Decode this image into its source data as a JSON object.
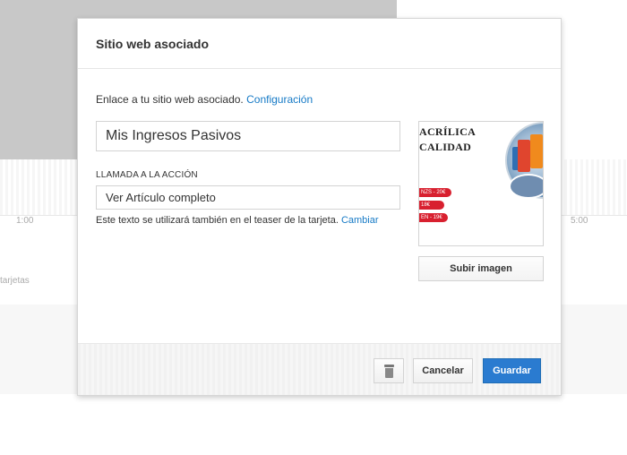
{
  "background": {
    "ticks": [
      "1:00",
      "5:00"
    ],
    "cards_label": "tarjetas"
  },
  "modal": {
    "title": "Sitio web asociado",
    "intro_text": "Enlace a tu sitio web asociado.",
    "intro_link": "Configuración",
    "title_field_value": "Mis Ingresos Pasivos",
    "cta_label": "LLAMADA A LA ACCIÓN",
    "cta_field_value": "Ver Artículo completo",
    "helper_text": "Este texto se utilizará también en el teaser de la tarjeta.",
    "helper_link": "Cambiar",
    "thumbnail": {
      "line1": "ACRÍLICA",
      "line2": "CALIDAD",
      "tags": [
        "NZS - 20€",
        "18€",
        "EN - 19€"
      ]
    },
    "upload_label": "Subir imagen",
    "footer": {
      "cancel_label": "Cancelar",
      "save_label": "Guardar"
    }
  },
  "colors": {
    "primary_button": "#2a7bd0",
    "link": "#167ac6"
  }
}
